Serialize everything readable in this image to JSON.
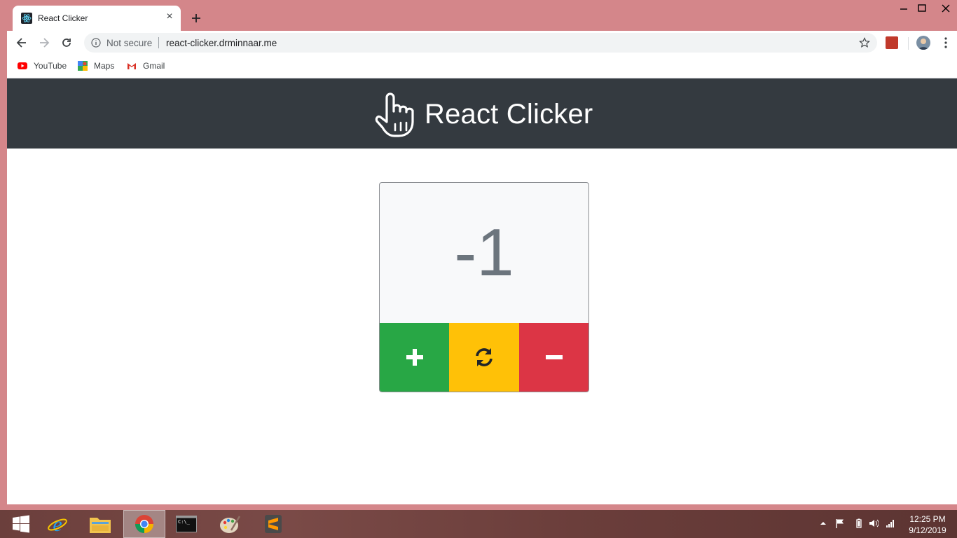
{
  "browser": {
    "tab_title": "React Clicker",
    "tab_close": "×",
    "new_tab": "+",
    "security_label": "Not secure",
    "url": "react-clicker.drminnaar.me",
    "bookmarks": [
      {
        "label": "YouTube",
        "icon": "youtube-icon"
      },
      {
        "label": "Maps",
        "icon": "maps-icon"
      },
      {
        "label": "Gmail",
        "icon": "gmail-icon"
      }
    ]
  },
  "app": {
    "title": "React Clicker",
    "brand_icon": "pointing-hand-icon",
    "counter_value": "-1",
    "buttons": [
      {
        "name": "increment",
        "icon": "plus-icon",
        "color": "#28a745"
      },
      {
        "name": "reset",
        "icon": "refresh-icon",
        "color": "#ffc107"
      },
      {
        "name": "decrement",
        "icon": "minus-icon",
        "color": "#dc3545"
      }
    ],
    "colors": {
      "navbar": "#343a40",
      "counter_text": "#6c757d",
      "card_bg": "#f8f9fa"
    }
  },
  "taskbar": {
    "apps": [
      "start-icon",
      "internet-explorer-icon",
      "file-explorer-icon",
      "chrome-icon",
      "command-prompt-icon",
      "paint-icon",
      "sublime-text-icon"
    ],
    "time": "12:25 PM",
    "date": "9/12/2019"
  }
}
